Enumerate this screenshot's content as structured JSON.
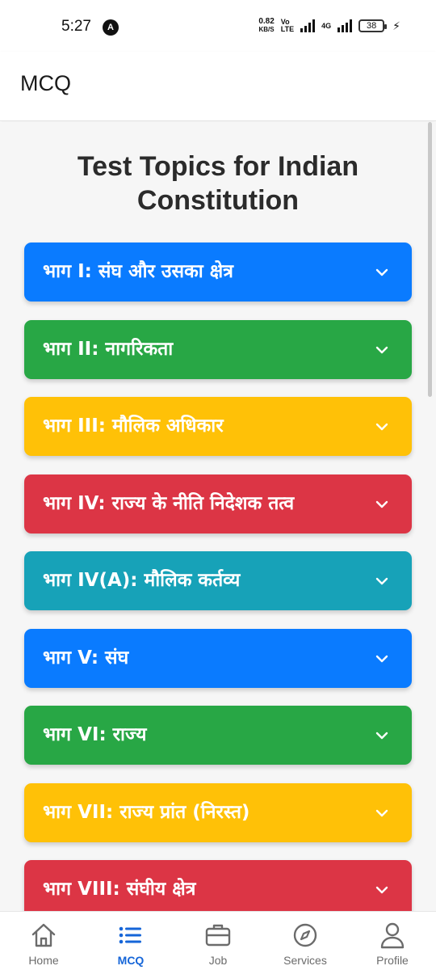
{
  "status_bar": {
    "time": "5:27",
    "app_icon_glyph": "A",
    "net_speed_value": "0.82",
    "net_speed_unit": "KB/S",
    "volte_top": "Vo",
    "volte_bottom": "LTE",
    "network_type": "4G",
    "battery": "38",
    "charging_icon": "lightning-icon"
  },
  "app_bar": {
    "title": "MCQ"
  },
  "page": {
    "heading": "Test Topics for Indian Constitution"
  },
  "colors": {
    "blue": "#0a7bff",
    "green": "#28a745",
    "yellow": "#ffc107",
    "red": "#dc3545",
    "teal": "#17a2b8",
    "nav_active": "#1565d8",
    "nav_inactive": "#6b6b6b"
  },
  "topics": [
    {
      "label": "भाग I: संघ और उसका क्षेत्र",
      "color": "#0a7bff",
      "text_color": "#ffffff"
    },
    {
      "label": "भाग II: नागरिकता",
      "color": "#28a745",
      "text_color": "#ffffff"
    },
    {
      "label": "भाग III: मौलिक अधिकार",
      "color": "#ffc107",
      "text_color": "#ffffff"
    },
    {
      "label": "भाग IV: राज्य के नीति निदेशक तत्व",
      "color": "#dc3545",
      "text_color": "#ffffff"
    },
    {
      "label": "भाग IV(A): मौलिक कर्तव्य",
      "color": "#17a2b8",
      "text_color": "#ffffff"
    },
    {
      "label": "भाग V: संघ",
      "color": "#0a7bff",
      "text_color": "#ffffff"
    },
    {
      "label": "भाग VI: राज्य",
      "color": "#28a745",
      "text_color": "#ffffff"
    },
    {
      "label": "भाग VII: राज्य प्रांत (निरस्त)",
      "color": "#ffc107",
      "text_color": "#ffffff"
    },
    {
      "label": "भाग VIII: संघीय क्षेत्र",
      "color": "#dc3545",
      "text_color": "#ffffff"
    }
  ],
  "bottom_nav": {
    "items": [
      {
        "label": "Home",
        "icon": "home-icon",
        "active": false
      },
      {
        "label": "MCQ",
        "icon": "list-icon",
        "active": true
      },
      {
        "label": "Job",
        "icon": "briefcase-icon",
        "active": false
      },
      {
        "label": "Services",
        "icon": "compass-icon",
        "active": false
      },
      {
        "label": "Profile",
        "icon": "user-icon",
        "active": false
      }
    ]
  }
}
